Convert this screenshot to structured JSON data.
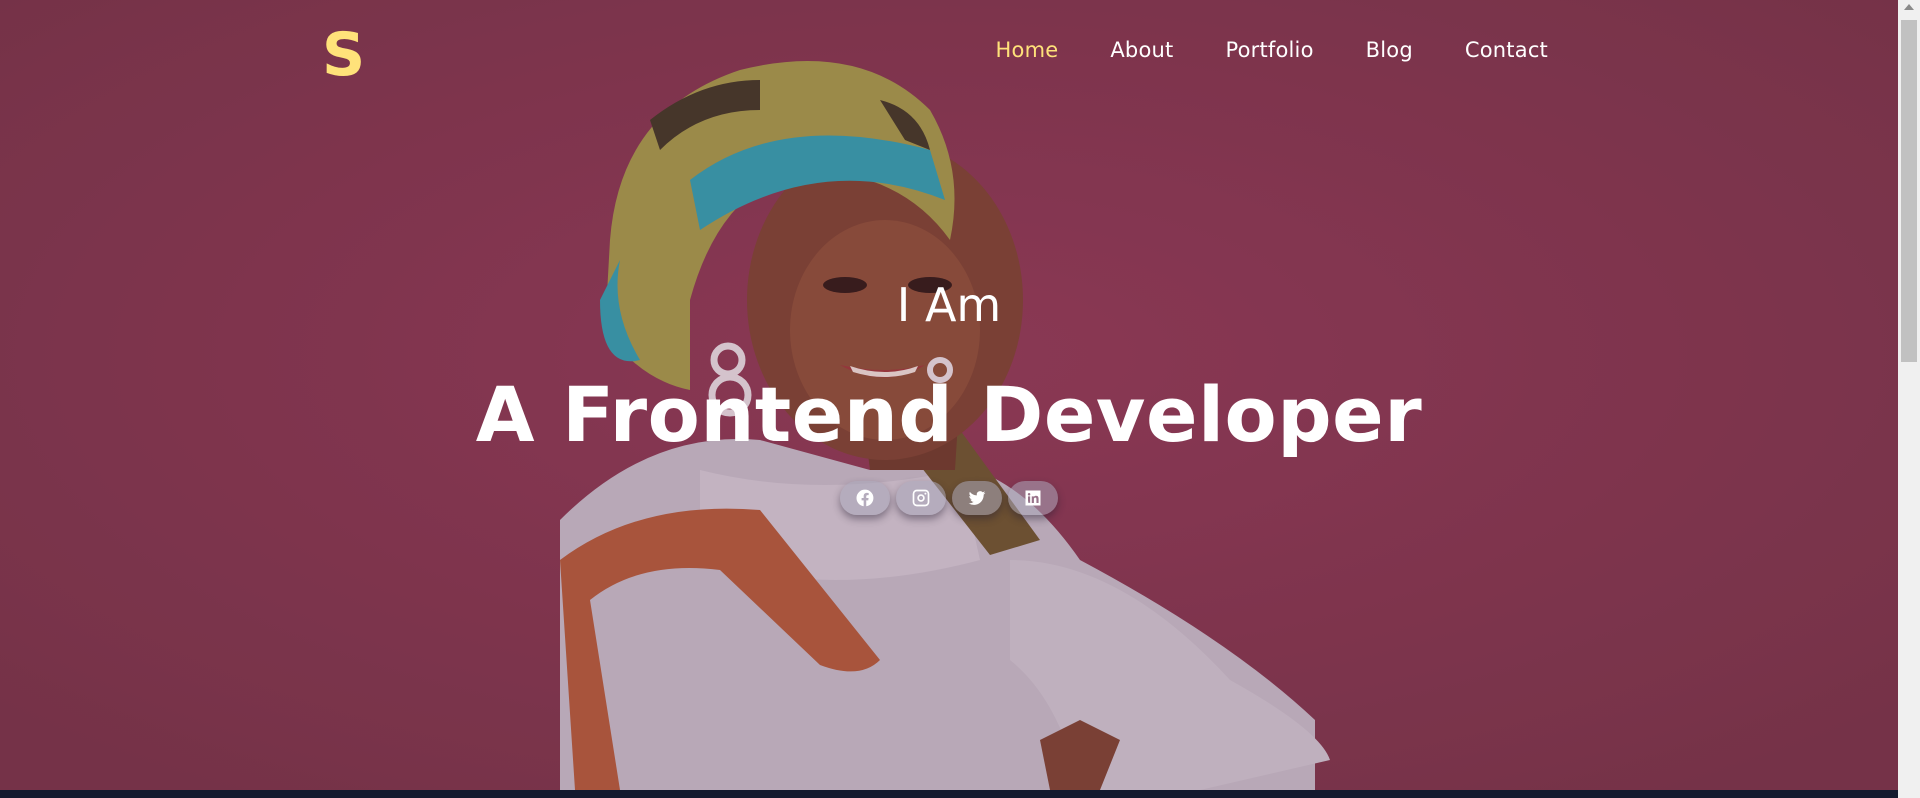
{
  "logo": "S",
  "nav": {
    "items": [
      {
        "label": "Home",
        "active": true
      },
      {
        "label": "About",
        "active": false
      },
      {
        "label": "Portfolio",
        "active": false
      },
      {
        "label": "Blog",
        "active": false
      },
      {
        "label": "Contact",
        "active": false
      }
    ]
  },
  "hero": {
    "intro": "I Am",
    "title": "A Frontend Developer"
  },
  "social": [
    {
      "icon": "facebook-icon"
    },
    {
      "icon": "instagram-icon"
    },
    {
      "icon": "twitter-icon"
    },
    {
      "icon": "linkedin-icon"
    }
  ],
  "colors": {
    "background": "#7c3a4d",
    "accent": "#ffe27a",
    "text": "#ffffff",
    "footer_strip": "#141a2e"
  }
}
